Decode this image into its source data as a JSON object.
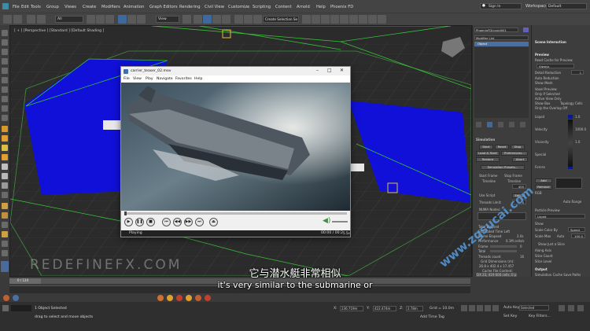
{
  "menubar": {
    "items": [
      "File",
      "Edit",
      "Tools",
      "Group",
      "Views",
      "Create",
      "Modifiers",
      "Animation",
      "Graph Editors",
      "Rendering",
      "Civil View",
      "Customize",
      "Scripting",
      "Content",
      "Arnold",
      "Help",
      "Phoenix FD"
    ],
    "sign_in": "Sign In",
    "workspaces_label": "Workspaces:",
    "workspace_value": "Default"
  },
  "toolbar": {
    "filter_value": "All",
    "view_value": "View",
    "selection_set": "Create Selection Se"
  },
  "viewport": {
    "label": "[ + ] [Perspective ] [Standard ] [Default Shading ]"
  },
  "command_panel": {
    "object_name": "PhoenixFDLiquid001",
    "modifier_list": "Modifier List",
    "stack_item": "Object",
    "simulation_title": "Simulation",
    "buttons": {
      "start": "Start",
      "reset": "Reset",
      "stop": "Stop",
      "load_start": "Load & Start",
      "preferences": "Preferences...",
      "restore": "Restore",
      "abort": "Abort",
      "sim_presets": "Simulation Presets..."
    },
    "start_frame": "Start Frame",
    "stop_frame": "Stop Frame",
    "timeline": "Timeline",
    "timeline2": "Timeline",
    "frame_value": "400",
    "use_script": "Use Script",
    "edit": "Edit...",
    "threads_limit": "Threads Limit:",
    "threads_value": "0",
    "numa_nodes": "NUMA Nodes:",
    "total_elapsed": "Total Elapsed",
    "est_time_left": "Estimated Time Left",
    "frame_elapsed": "Frame Elapsed",
    "frame_elapsed_value": "2.0s",
    "performance": "Performance",
    "performance_value": "0.1M cells/s",
    "frame": "Frame",
    "frame_num": "0",
    "total": "Total",
    "threads_count": "Threads count",
    "threads_count_value": "16",
    "grid_dims_label": "Grid Dimensions (m):",
    "grid_dims_value": "26.8 x 402.4 x 17.457",
    "cache_content": "Cache File Content:",
    "cache_value": "DX 23, 419 600 cells, 0 p"
  },
  "right_panel": {
    "scene_interaction": "Scene Interaction",
    "preview": "Preview",
    "read_cache": "Read Cache for Preview:",
    "read_cache_value": "Always",
    "detail_reduction": "Detail Reduction",
    "detail_value": "1",
    "auto_reduction": "Auto Reduction",
    "show_mesh": "Show Mesh",
    "voxel_preview": "Voxel Preview:",
    "only_if_selected": "Only If Selected",
    "active_view_only": "Active View Only",
    "show_box": "Show Box",
    "topology_cells": "Topology Cells",
    "only_overlap_off": "Only the Overlap Off",
    "channels": [
      {
        "name": "Liquid",
        "value": "1.0",
        "color": "#0a1a8a"
      },
      {
        "name": "Velocity",
        "value": "1000.0",
        "color": "#0a1a8a"
      },
      {
        "name": "Viscosity",
        "value": "1.0",
        "color": "#c05a10"
      },
      {
        "name": "Special",
        "value": "",
        "color": "#c0c0c0"
      },
      {
        "name": "Forces",
        "value": "",
        "color": "#0a1a8a"
      }
    ],
    "add": "Add",
    "remove": "Remove",
    "rgb": "RGB",
    "auto_range": "Auto Range",
    "particle_preview": "Particle Preview",
    "particle_value": "Liquid",
    "show": "Show",
    "scale_color_by": "Scale Color By",
    "speed": "Speed",
    "scale_max": "Scale Max",
    "auto": "Auto",
    "scale_max_value": "100.0",
    "show_just_a_slice": "Show Just a Slice",
    "along_axis": "Along Axis",
    "slice_count": "Slice Count",
    "slice_level": "Slice Level",
    "output": "Output",
    "sim_cache_save": "Simulation Cache Save Paths"
  },
  "player": {
    "title": "carrier_teaser_02.mov",
    "menu": [
      "File",
      "View",
      "Play",
      "Navigate",
      "Favorites",
      "Help"
    ],
    "status": "Playing",
    "time": "00:00 / 00:2",
    "time_suffix": "5.5x"
  },
  "timeline": {
    "frame_display": "0 / 124"
  },
  "bottombar": {
    "objects_selected": "1 Object Selected",
    "hint": "drag to select and move objects",
    "x_label": "X:",
    "x_value": "236.719m",
    "y_label": "Y:",
    "y_value": "422.474m",
    "z_label": "Z:",
    "z_value": "2.78m",
    "grid_label": "Grid = 10.0m",
    "add_time_tag": "Add Time Tag",
    "auto_key": "Auto Key",
    "set_key": "Set Key",
    "selected": "Selected",
    "key_filters": "Key Filters..."
  },
  "subtitles": {
    "cn": "它与潜水艇非常相似",
    "en": "it's very similar to the submarine or"
  },
  "branding": {
    "brand": "REDEFINEFX.COM",
    "watermark": "www.zgsucai.com"
  }
}
